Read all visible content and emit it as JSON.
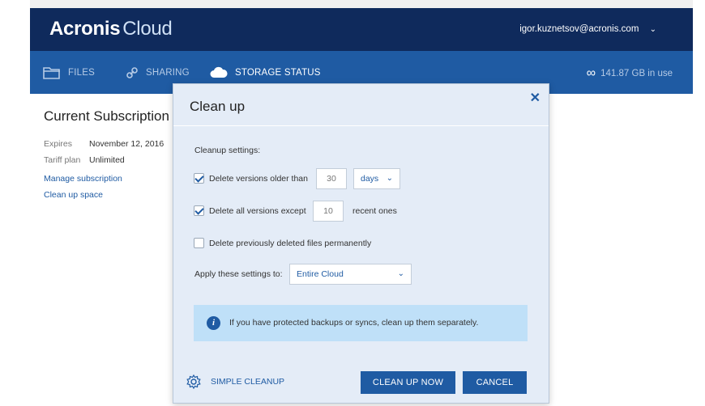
{
  "header": {
    "logo_brand": "Acronis",
    "logo_product": "Cloud",
    "user_email": "igor.kuznetsov@acronis.com"
  },
  "nav": {
    "files": "FILES",
    "sharing": "SHARING",
    "storage_status": "STORAGE STATUS",
    "usage": "141.87 GB in use"
  },
  "subscription": {
    "title": "Current Subscription",
    "expires_label": "Expires",
    "expires_value": "November 12, 2016",
    "tariff_label": "Tariff plan",
    "tariff_value": "Unlimited",
    "manage_link": "Manage subscription",
    "cleanup_link": "Clean up space"
  },
  "dialog": {
    "title": "Clean up",
    "settings_label": "Cleanup settings:",
    "opt_older": {
      "label": "Delete versions older than",
      "checked": true,
      "value": "30",
      "unit": "days"
    },
    "opt_except": {
      "label": "Delete all versions except",
      "checked": true,
      "value": "10",
      "suffix": "recent ones"
    },
    "opt_deleted": {
      "label": "Delete previously deleted files permanently",
      "checked": false
    },
    "apply_label": "Apply these settings to:",
    "apply_value": "Entire Cloud",
    "info_text": "If you have protected backups or syncs, clean up them separately.",
    "simple_cleanup": "SIMPLE CLEANUP",
    "clean_now": "CLEAN UP NOW",
    "cancel": "CANCEL"
  },
  "colors": {
    "header_bg": "#0f2a5c",
    "nav_bg": "#1f5ba3",
    "dialog_bg": "#e4ecf7",
    "info_bg": "#bfe0f8"
  }
}
